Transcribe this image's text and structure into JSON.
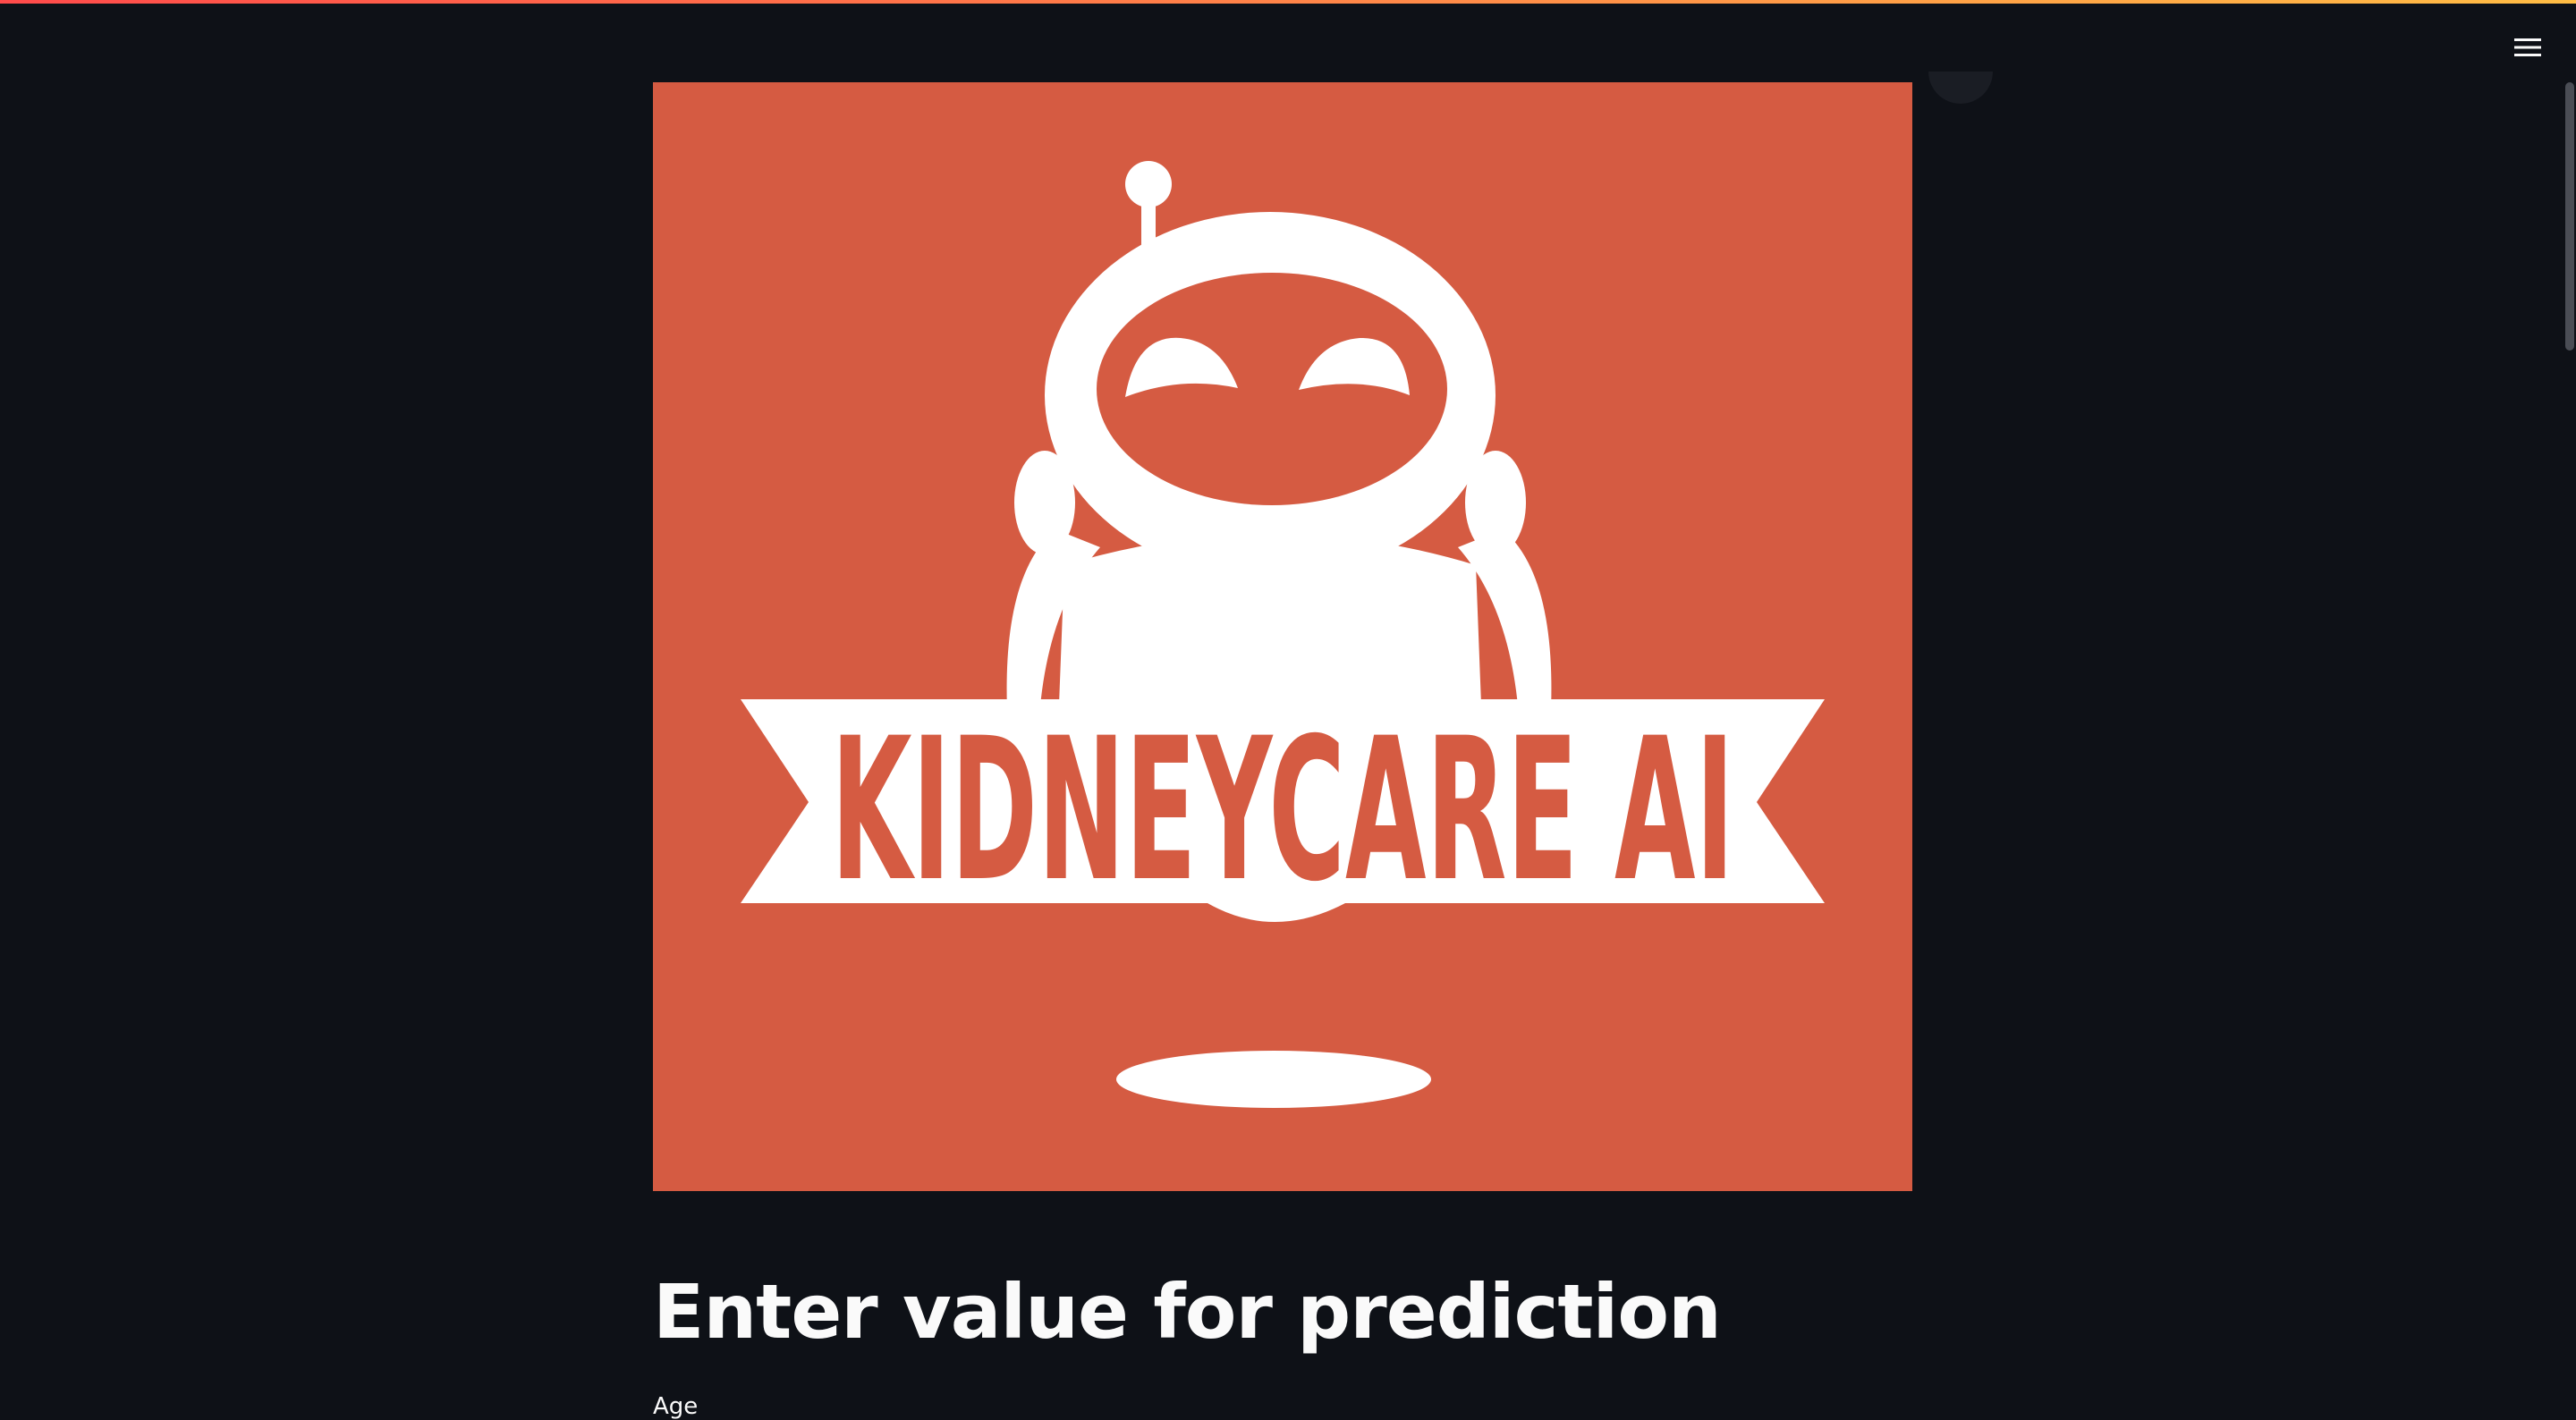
{
  "header": {
    "menu_icon": "hamburger-menu-icon"
  },
  "logo": {
    "alt": "KidneyCare AI logo",
    "wordmark": "KIDNEYCARE AI",
    "background_color": "#d55b42",
    "foreground_color": "#ffffff"
  },
  "main": {
    "title": "Enter value for prediction",
    "first_field_label": "Age"
  },
  "colors": {
    "app_background": "#0e1117",
    "text": "#fafafa",
    "accent_gradient_start": "#ff4b4b",
    "accent_gradient_end": "#ffbd45"
  }
}
